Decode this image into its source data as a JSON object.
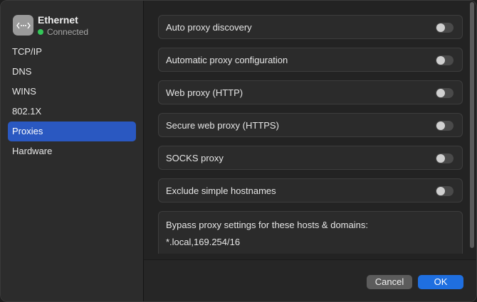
{
  "interface": {
    "name": "Ethernet",
    "status": "Connected",
    "icon": "network-icon",
    "status_color": "#34c759"
  },
  "sidebar": {
    "items": [
      {
        "label": "TCP/IP",
        "selected": false
      },
      {
        "label": "DNS",
        "selected": false
      },
      {
        "label": "WINS",
        "selected": false
      },
      {
        "label": "802.1X",
        "selected": false
      },
      {
        "label": "Proxies",
        "selected": true
      },
      {
        "label": "Hardware",
        "selected": false
      }
    ],
    "accent_color": "#2a58c1"
  },
  "proxies": [
    {
      "label": "Auto proxy discovery",
      "enabled": false
    },
    {
      "label": "Automatic proxy configuration",
      "enabled": false
    },
    {
      "label": "Web proxy (HTTP)",
      "enabled": false
    },
    {
      "label": "Secure web proxy (HTTPS)",
      "enabled": false
    },
    {
      "label": "SOCKS proxy",
      "enabled": false
    },
    {
      "label": "Exclude simple hostnames",
      "enabled": false
    }
  ],
  "bypass": {
    "label": "Bypass proxy settings for these hosts & domains:",
    "value": "*.local,169.254/16"
  },
  "footer": {
    "cancel_label": "Cancel",
    "ok_label": "OK",
    "ok_color": "#1f6fe0"
  }
}
